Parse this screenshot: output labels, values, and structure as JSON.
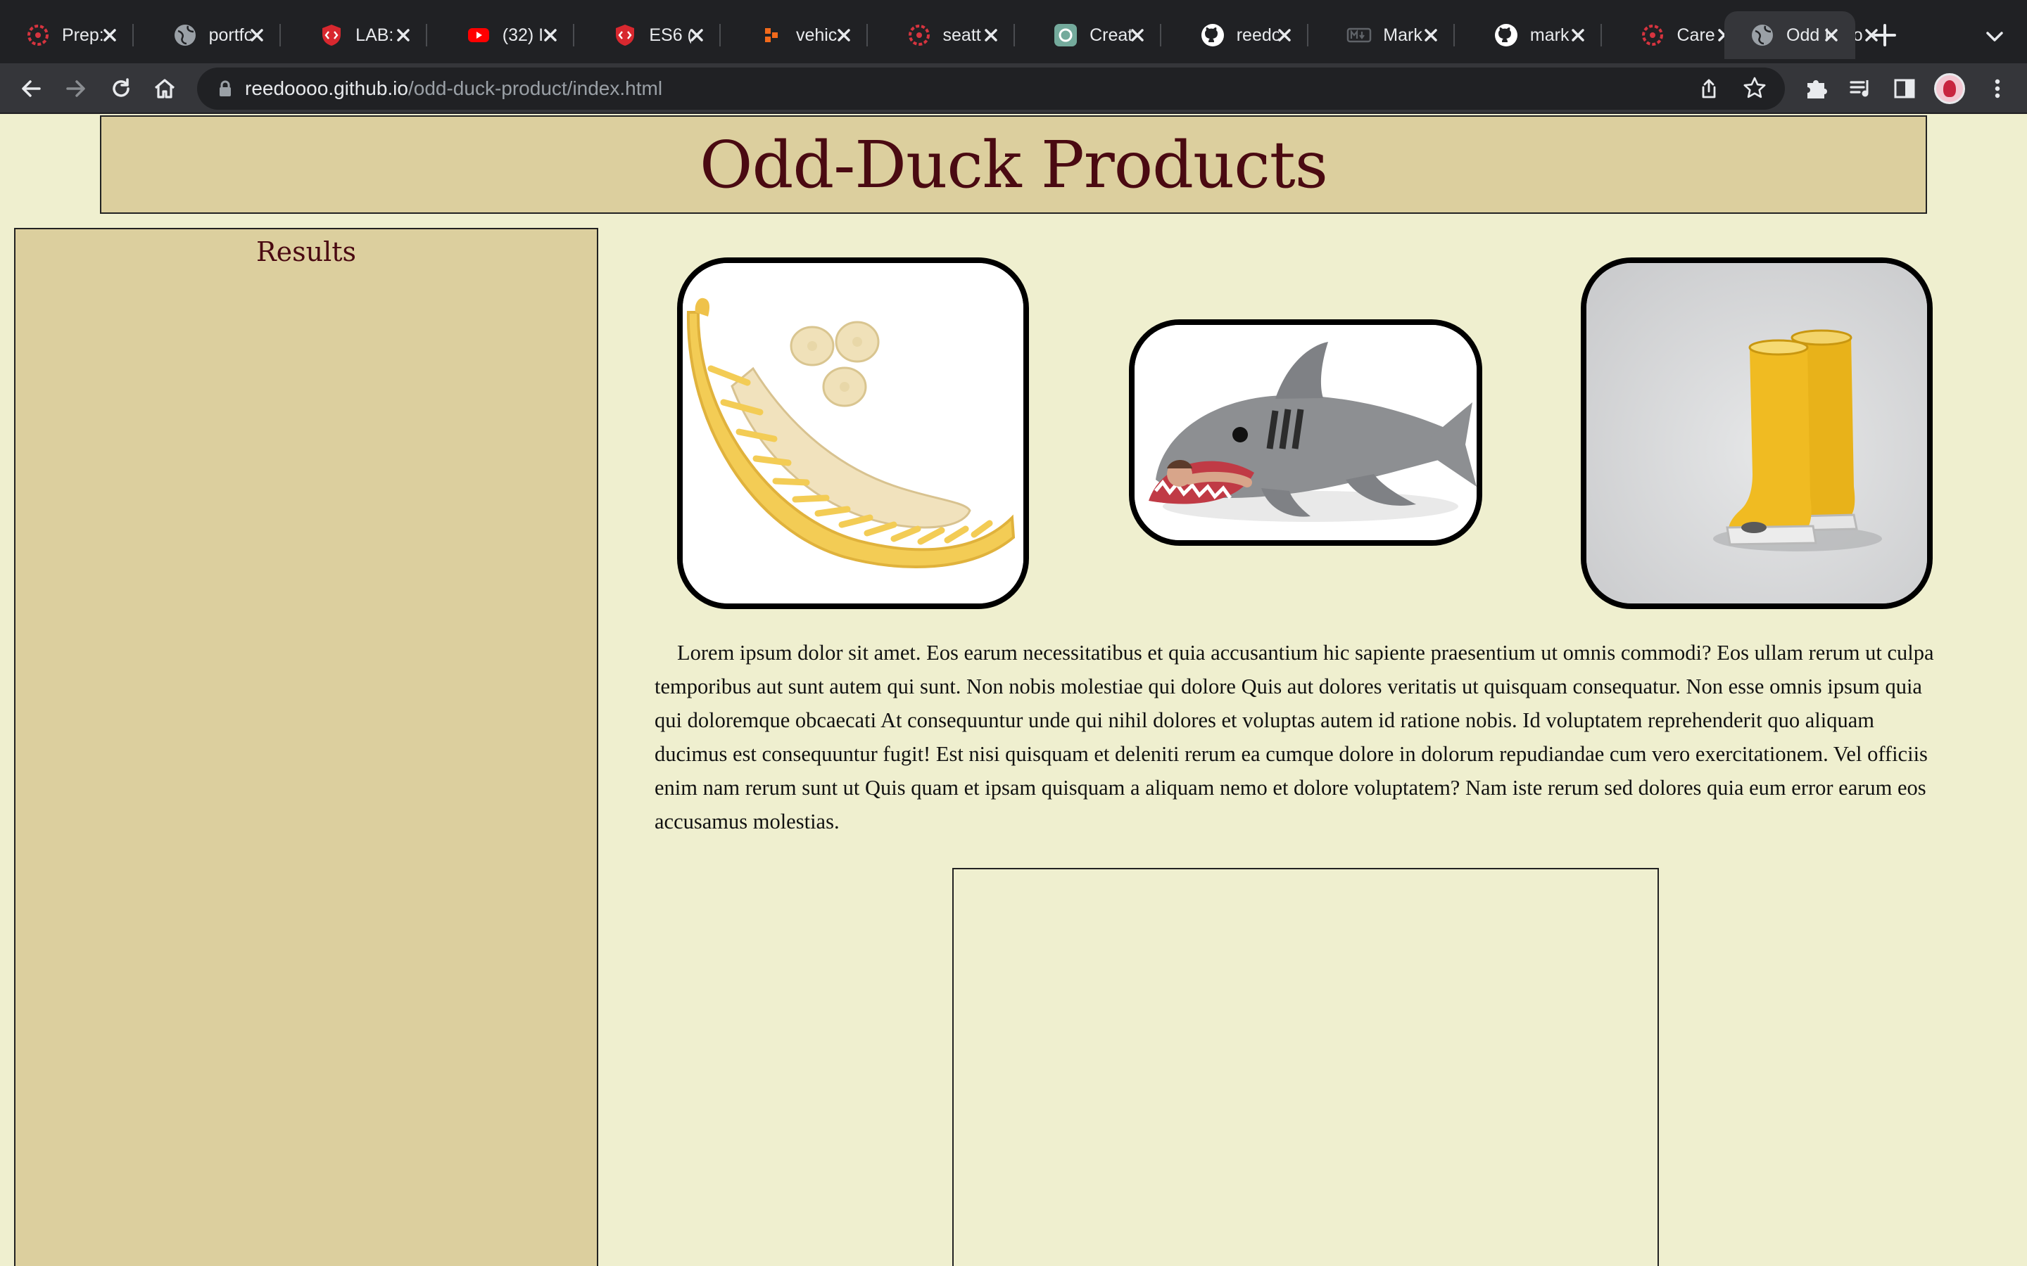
{
  "browser": {
    "tabs": [
      {
        "title": "Prep:",
        "icon": "codefellows-icon",
        "active": false
      },
      {
        "title": "portfo",
        "icon": "globe-icon",
        "active": false
      },
      {
        "title": "LAB:",
        "icon": "code-shield-icon",
        "active": false
      },
      {
        "title": "(32) I",
        "icon": "youtube-icon",
        "active": false
      },
      {
        "title": "ES6 (",
        "icon": "code-shield-icon",
        "active": false
      },
      {
        "title": "vehic",
        "icon": "orange-blocks-icon",
        "active": false
      },
      {
        "title": "seatt",
        "icon": "codefellows-icon",
        "active": false
      },
      {
        "title": "Creat",
        "icon": "openai-icon",
        "active": false
      },
      {
        "title": "reedo",
        "icon": "github-icon",
        "active": false
      },
      {
        "title": "Mark",
        "icon": "markdown-icon",
        "active": false
      },
      {
        "title": "mark",
        "icon": "github-icon",
        "active": false
      },
      {
        "title": "Care",
        "icon": "codefellows-icon",
        "active": false
      },
      {
        "title": "E-Po",
        "icon": "globe-icon",
        "active": false
      },
      {
        "title": "Odd I",
        "icon": "globe-icon",
        "active": true
      }
    ],
    "address": {
      "host": "reedoooo.github.io",
      "path": "/odd-duck-product/index.html"
    }
  },
  "page": {
    "title": "Odd-Duck Products",
    "results_heading": "Results",
    "products": [
      {
        "name": "banana-slicer-image"
      },
      {
        "name": "shark-sleeping-bag-image"
      },
      {
        "name": "rain-boots-image"
      }
    ],
    "lorem": "Lorem ipsum dolor sit amet. Eos earum necessitatibus et quia accusantium hic sapiente praesentium ut omnis commodi? Eos ullam rerum ut culpa temporibus aut sunt autem qui sunt. Non nobis molestiae qui dolore Quis aut dolores veritatis ut quisquam consequatur. Non esse omnis ipsum quia qui doloremque obcaecati At consequuntur unde qui nihil dolores et voluptas autem id ratione nobis. Id voluptatem reprehenderit quo aliquam ducimus est consequuntur fugit! Est nisi quisquam et deleniti rerum ea cumque dolore in dolorum repudiandae cum vero exercitationem. Vel officiis enim nam rerum sunt ut Quis quam et ipsam quisquam a aliquam nemo et dolore voluptatem? Nam iste rerum sed dolores quia eum error earum eos accusamus molestias."
  },
  "colors": {
    "page_bg": "#efefcf",
    "panel_bg": "#dccf9e",
    "title_color": "#4a0a12",
    "chrome_dark": "#202124",
    "chrome_toolbar": "#35363a"
  }
}
